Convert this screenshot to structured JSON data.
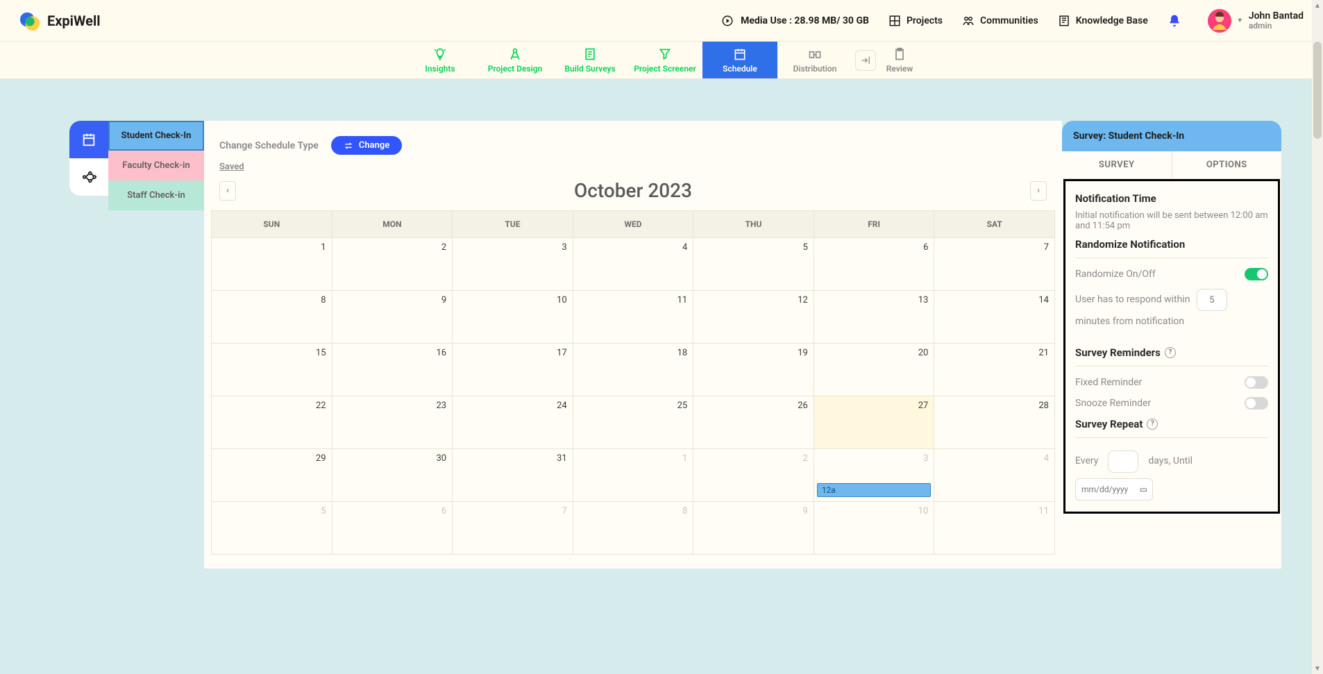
{
  "brand": "ExpiWell",
  "top": {
    "media_use": "Media Use : 28.98 MB/ 30 GB",
    "projects": "Projects",
    "communities": "Communities",
    "knowledge": "Knowledge Base"
  },
  "user": {
    "name": "John Bantad",
    "role": "admin"
  },
  "projnav": {
    "insights": "Insights",
    "design": "Project Design",
    "build": "Build Surveys",
    "screener": "Project Screener",
    "schedule": "Schedule",
    "distribution": "Distribution",
    "review": "Review"
  },
  "surveys": {
    "student": "Student Check-In",
    "faculty": "Faculty Check-in",
    "staff": "Staff Check-in"
  },
  "calendar": {
    "change_label": "Change Schedule Type",
    "change_btn": "Change",
    "saved": "Saved",
    "title": "October 2023",
    "prev": "‹",
    "next": "›",
    "days": {
      "sun": "SUN",
      "mon": "MON",
      "tue": "TUE",
      "wed": "WED",
      "thu": "THU",
      "fri": "FRI",
      "sat": "SAT"
    },
    "weeks": [
      [
        "1",
        "2",
        "3",
        "4",
        "5",
        "6",
        "7"
      ],
      [
        "8",
        "9",
        "10",
        "11",
        "12",
        "13",
        "14"
      ],
      [
        "15",
        "16",
        "17",
        "18",
        "19",
        "20",
        "21"
      ],
      [
        "22",
        "23",
        "24",
        "25",
        "26",
        "27",
        "28"
      ],
      [
        "29",
        "30",
        "31",
        "1",
        "2",
        "3",
        "4"
      ],
      [
        "5",
        "6",
        "7",
        "8",
        "9",
        "10",
        "11"
      ]
    ],
    "event_label": "12a"
  },
  "panel": {
    "header": "Survey: Student Check-In",
    "tab_survey": "SURVEY",
    "tab_options": "OPTIONS",
    "notif_title": "Notification Time",
    "notif_note": "Initial notification will be sent between 12:00 am and 11:54 pm",
    "randomize_title": "Randomize Notification",
    "randomize_label": "Randomize On/Off",
    "respond_a": "User has to respond within",
    "respond_placeholder": "5",
    "respond_b": "minutes from notification",
    "reminders_title": "Survey Reminders",
    "fixed_label": "Fixed Reminder",
    "snooze_label": "Snooze Reminder",
    "repeat_title": "Survey Repeat",
    "every": "Every",
    "days_until": "days, Until",
    "date_placeholder": "mm/dd/yyyy"
  }
}
